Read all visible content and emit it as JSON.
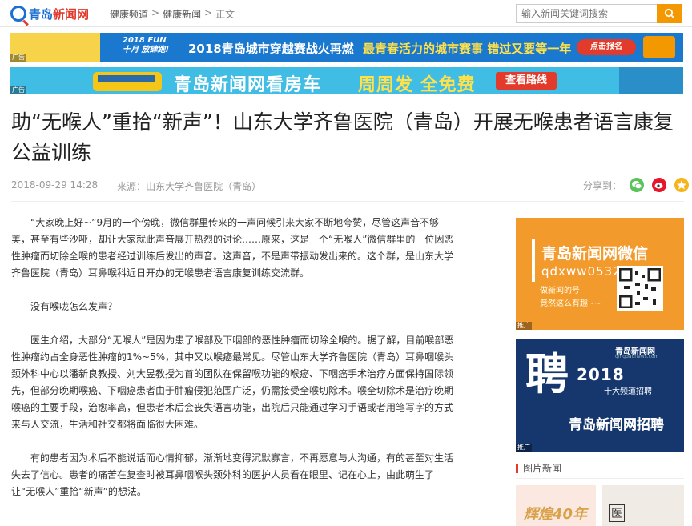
{
  "header": {
    "logo_text_blue": "青岛",
    "logo_text_red": "新闻网",
    "breadcrumb": [
      "健康频道",
      "健康新闻",
      "正文"
    ],
    "breadcrumb_sep": ">",
    "search_placeholder": "输入新闻关键词搜索"
  },
  "ads": {
    "ad1": {
      "year_fun": "2018 FUN十月 放肆跑!",
      "headline": "2018青岛城市穿越赛战火再燃",
      "slogan": "最青春活力的城市赛事 错过又要等一年",
      "button": "点击报名",
      "tag": "广告"
    },
    "ad2": {
      "headline": "青岛新闻网看房车",
      "slogan": "周周发 全免费",
      "button": "查看路线",
      "tag": "广告"
    }
  },
  "article": {
    "title": "助“无喉人”重拾“新声”！山东大学齐鲁医院（青岛）开展无喉患者语言康复公益训练",
    "date": "2018-09-29 14:28",
    "source": "来源：山东大学齐鲁医院（青岛）",
    "share_label": "分享到：",
    "paragraphs": [
      "“大家晚上好~”9月的一个傍晚，微信群里传来的一声问候引来大家不断地夸赞，尽管这声音不够美，甚至有些沙哑，却让大家就此声音展开热烈的讨论……原来，这是一个“无喉人”微信群里的一位因恶性肿瘤而切除全喉的患者经过训练后发出的声音。这声音，不是声带振动发出来的。这个群，是山东大学齐鲁医院（青岛）耳鼻喉科近日开办的无喉患者语言康复训练交流群。",
      "没有喉咙怎么发声？",
      "医生介绍，大部分“无喉人”是因为患了喉部及下咽部的恶性肿瘤而切除全喉的。据了解，目前喉部恶性肿瘤约占全身恶性肿瘤的1%~5%，其中又以喉癌最常见。尽管山东大学齐鲁医院（青岛）耳鼻咽喉头颈外科中心以潘新良教授、刘大昱教授为首的团队在保留喉功能的喉癌、下咽癌手术治疗方面保持国际领先，但部分晚期喉癌、下咽癌患者由于肿瘤侵犯范围广泛，仍需接受全喉切除术。喉全切除术是治疗晚期喉癌的主要手段，治愈率高，但患者术后会丧失语言功能，出院后只能通过学习手语或者用笔写字的方式来与人交流，生活和社交都将面临很大困难。",
      "有的患者因为术后不能说话而心情抑郁，渐渐地变得沉默寡言，不再愿意与人沟通，有的甚至对生活失去了信心。患者的痛苦在复查时被耳鼻咽喉头颈外科的医护人员看在眼里、记在心上，由此萌生了让“无喉人”重拾“新声”的想法。"
    ]
  },
  "sidebar": {
    "weixin": {
      "title": "青岛新闻网微信",
      "id": "qdxww0532",
      "line1": "做新闻的号",
      "line2": "竟然这么有趣~~",
      "tag": "推广"
    },
    "hire": {
      "big_char": "聘",
      "year": "2018",
      "sub": "十大频道招聘",
      "headline": "青岛新闻网招聘",
      "logo": "青岛新闻网",
      "logo_sub": "qingdaonews.com",
      "tag": "推广"
    },
    "pic_section_title": "图片新闻",
    "pic1_text": "辉煌40年",
    "pic2_text": "医"
  },
  "colors": {
    "brand_blue": "#1a6fd1",
    "brand_red": "#e23a2b",
    "search_button": "#f39800",
    "weixin_orange": "#f39a2c",
    "hire_navy": "#15376e"
  }
}
